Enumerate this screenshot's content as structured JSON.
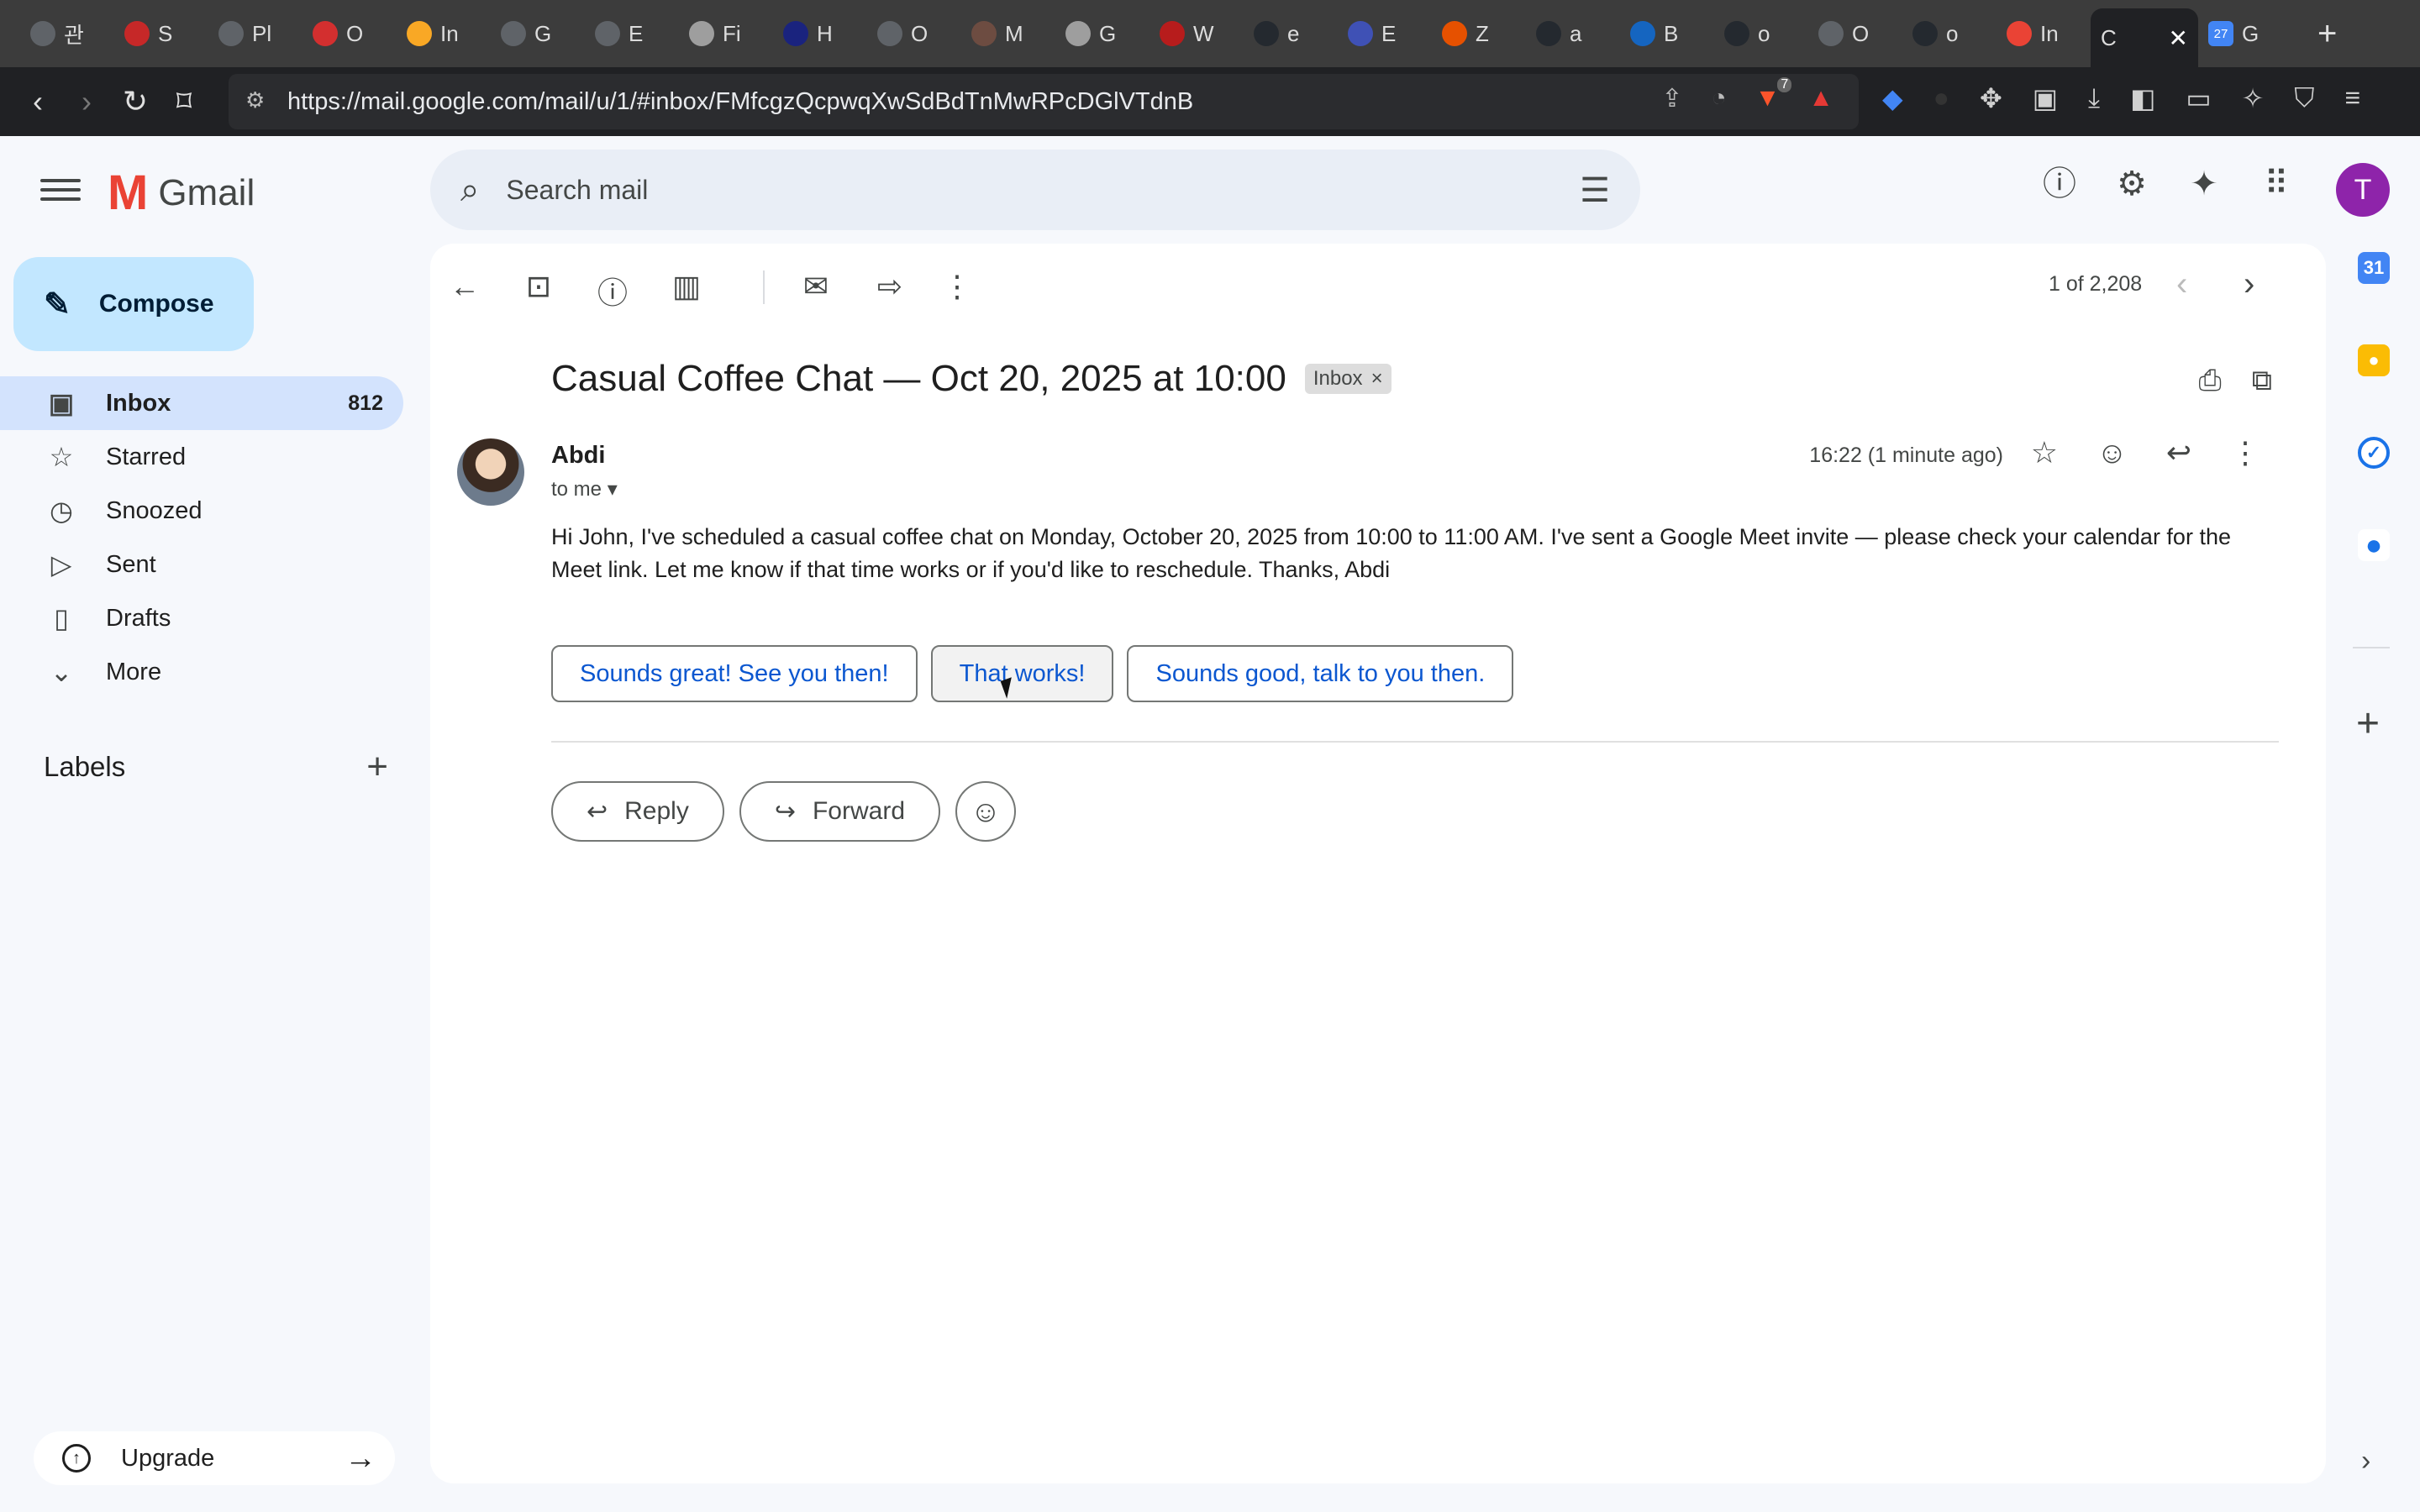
{
  "browser": {
    "tabs": [
      {
        "title": "관",
        "color": "#5f6368"
      },
      {
        "title": "S",
        "color": "#c62828"
      },
      {
        "title": "Pl",
        "color": "#5f6368"
      },
      {
        "title": "O",
        "color": "#d32f2f"
      },
      {
        "title": "In",
        "color": "#f9a825"
      },
      {
        "title": "G",
        "color": "#5f6368"
      },
      {
        "title": "E",
        "color": "#5f6368"
      },
      {
        "title": "Fi",
        "color": "#9e9e9e"
      },
      {
        "title": "H",
        "color": "#1a237e"
      },
      {
        "title": "O",
        "color": "#5f6368"
      },
      {
        "title": "M",
        "color": "#6d4c41"
      },
      {
        "title": "G",
        "color": "#9e9e9e"
      },
      {
        "title": "W",
        "color": "#b71c1c"
      },
      {
        "title": "e",
        "color": "#24292f"
      },
      {
        "title": "E",
        "color": "#3f51b5"
      },
      {
        "title": "Z",
        "color": "#e65100"
      },
      {
        "title": "a",
        "color": "#24292f"
      },
      {
        "title": "B",
        "color": "#1565c0"
      },
      {
        "title": "o",
        "color": "#24292f"
      },
      {
        "title": "O",
        "color": "#5f6368"
      },
      {
        "title": "o",
        "color": "#24292f"
      },
      {
        "title": "In",
        "color": "#ea4335"
      }
    ],
    "active_tab": {
      "title": "C",
      "close": "✕"
    },
    "last_tab": {
      "title": "G",
      "badge": "27"
    },
    "new_tab": "+",
    "url": "https://mail.google.com/mail/u/1/#inbox/FMfcgzQcpwqXwSdBdTnMwRPcDGlVTdnB",
    "brave_badge": "7"
  },
  "gmail": {
    "logo_m": "M",
    "logo_word": "Gmail",
    "search_placeholder": "Search mail",
    "avatar_letter": "T",
    "compose_label": "Compose",
    "nav": [
      {
        "label": "Inbox",
        "count": "812",
        "icon": "inbox-icon"
      },
      {
        "label": "Starred",
        "count": "",
        "icon": "star-icon"
      },
      {
        "label": "Snoozed",
        "count": "",
        "icon": "clock-icon"
      },
      {
        "label": "Sent",
        "count": "",
        "icon": "send-icon"
      },
      {
        "label": "Drafts",
        "count": "",
        "icon": "draft-icon"
      },
      {
        "label": "More",
        "count": "",
        "icon": "chevron-down-icon"
      }
    ],
    "labels_title": "Labels",
    "upgrade_label": "Upgrade"
  },
  "message": {
    "pager": "1 of 2,208",
    "subject": "Casual Coffee Chat — Oct 20, 2025 at 10:00",
    "label_chip": "Inbox",
    "sender": "Abdi",
    "to": "to me",
    "time": "16:22 (1 minute ago)",
    "body": "Hi John, I've scheduled a casual coffee chat on Monday, October 20, 2025 from 10:00 to 11:00 AM. I've sent a Google Meet invite — please check your calendar for the Meet link. Let me know if that time works or if you'd like to reschedule. Thanks, Abdi",
    "smart_replies": [
      "Sounds great! See you then!",
      "That works!",
      "Sounds good, talk to you then."
    ],
    "reply_label": "Reply",
    "forward_label": "Forward"
  },
  "side_panel": {
    "calendar_day": "31"
  },
  "colors": {
    "accent": "#0b57d0",
    "compose_bg": "#c2e7ff",
    "active_nav_bg": "#d3e3fd"
  }
}
